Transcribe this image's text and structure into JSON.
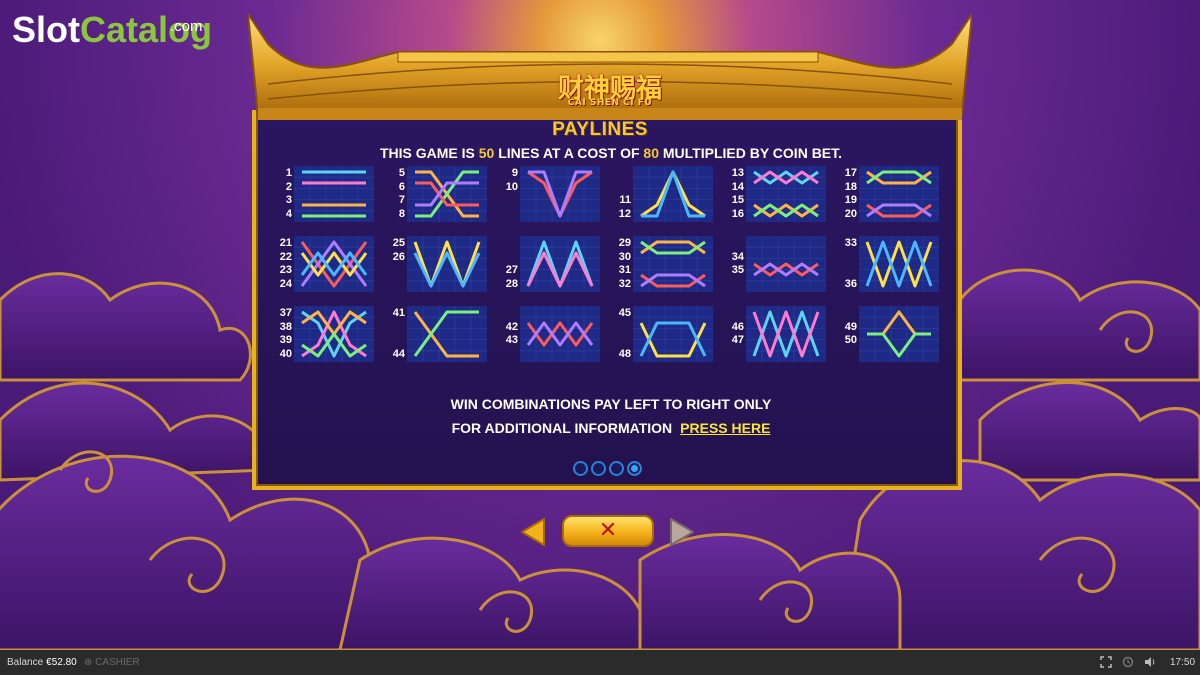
{
  "watermark": {
    "slot": "Slot",
    "catalog": "Catalog",
    "com": ".com"
  },
  "logo": {
    "chinese": "财神赐福",
    "english": "CAI SHEN CI FU"
  },
  "title": "PAYLINES",
  "subtitle": {
    "prefix": "THIS GAME IS ",
    "lines": "50",
    "middle": " LINES AT A COST OF ",
    "cost": "80",
    "suffix": " MULTIPLIED BY COIN BET."
  },
  "paylines": [
    {
      "labels": [
        "1",
        "2",
        "3",
        "4"
      ]
    },
    {
      "labels": [
        "5",
        "6",
        "7",
        "8"
      ]
    },
    {
      "labels": [
        "9",
        "10"
      ]
    },
    {
      "labels": [
        "11",
        "12"
      ]
    },
    {
      "labels": [
        "13",
        "14",
        "15",
        "16"
      ]
    },
    {
      "labels": [
        "17",
        "18",
        "19",
        "20"
      ]
    },
    {
      "labels": [
        "21",
        "22",
        "23",
        "24"
      ]
    },
    {
      "labels": [
        "25",
        "26"
      ]
    },
    {
      "labels": [
        "27",
        "28"
      ]
    },
    {
      "labels": [
        "29",
        "30",
        "31",
        "32"
      ]
    },
    {
      "labels": [
        "34",
        "35"
      ]
    },
    {
      "labels": [
        "33",
        "36"
      ]
    },
    {
      "labels": [
        "37",
        "38",
        "39",
        "40"
      ]
    },
    {
      "labels": [
        "41",
        "44"
      ]
    },
    {
      "labels": [
        "42",
        "43"
      ]
    },
    {
      "labels": [
        "45",
        "48"
      ]
    },
    {
      "labels": [
        "46",
        "47"
      ]
    },
    {
      "labels": [
        "49",
        "50"
      ]
    }
  ],
  "info": {
    "line1": "WIN COMBINATIONS PAY LEFT TO RIGHT ONLY",
    "line2": "FOR ADDITIONAL INFORMATION",
    "link": "PRESS HERE"
  },
  "pagination": {
    "pages": 4,
    "active": 4
  },
  "controls": {
    "close": "✕",
    "prev": "previous-arrow-icon",
    "next": "next-arrow-icon"
  },
  "statusbar": {
    "balance_label": "Balance",
    "balance_value": "€52.80",
    "cashier": "CASHIER",
    "time": "17:50"
  },
  "colors": {
    "gold": "#e6b21f",
    "panel": "#24124f",
    "accent_text": "#f6c838",
    "link": "#f6e63a"
  }
}
